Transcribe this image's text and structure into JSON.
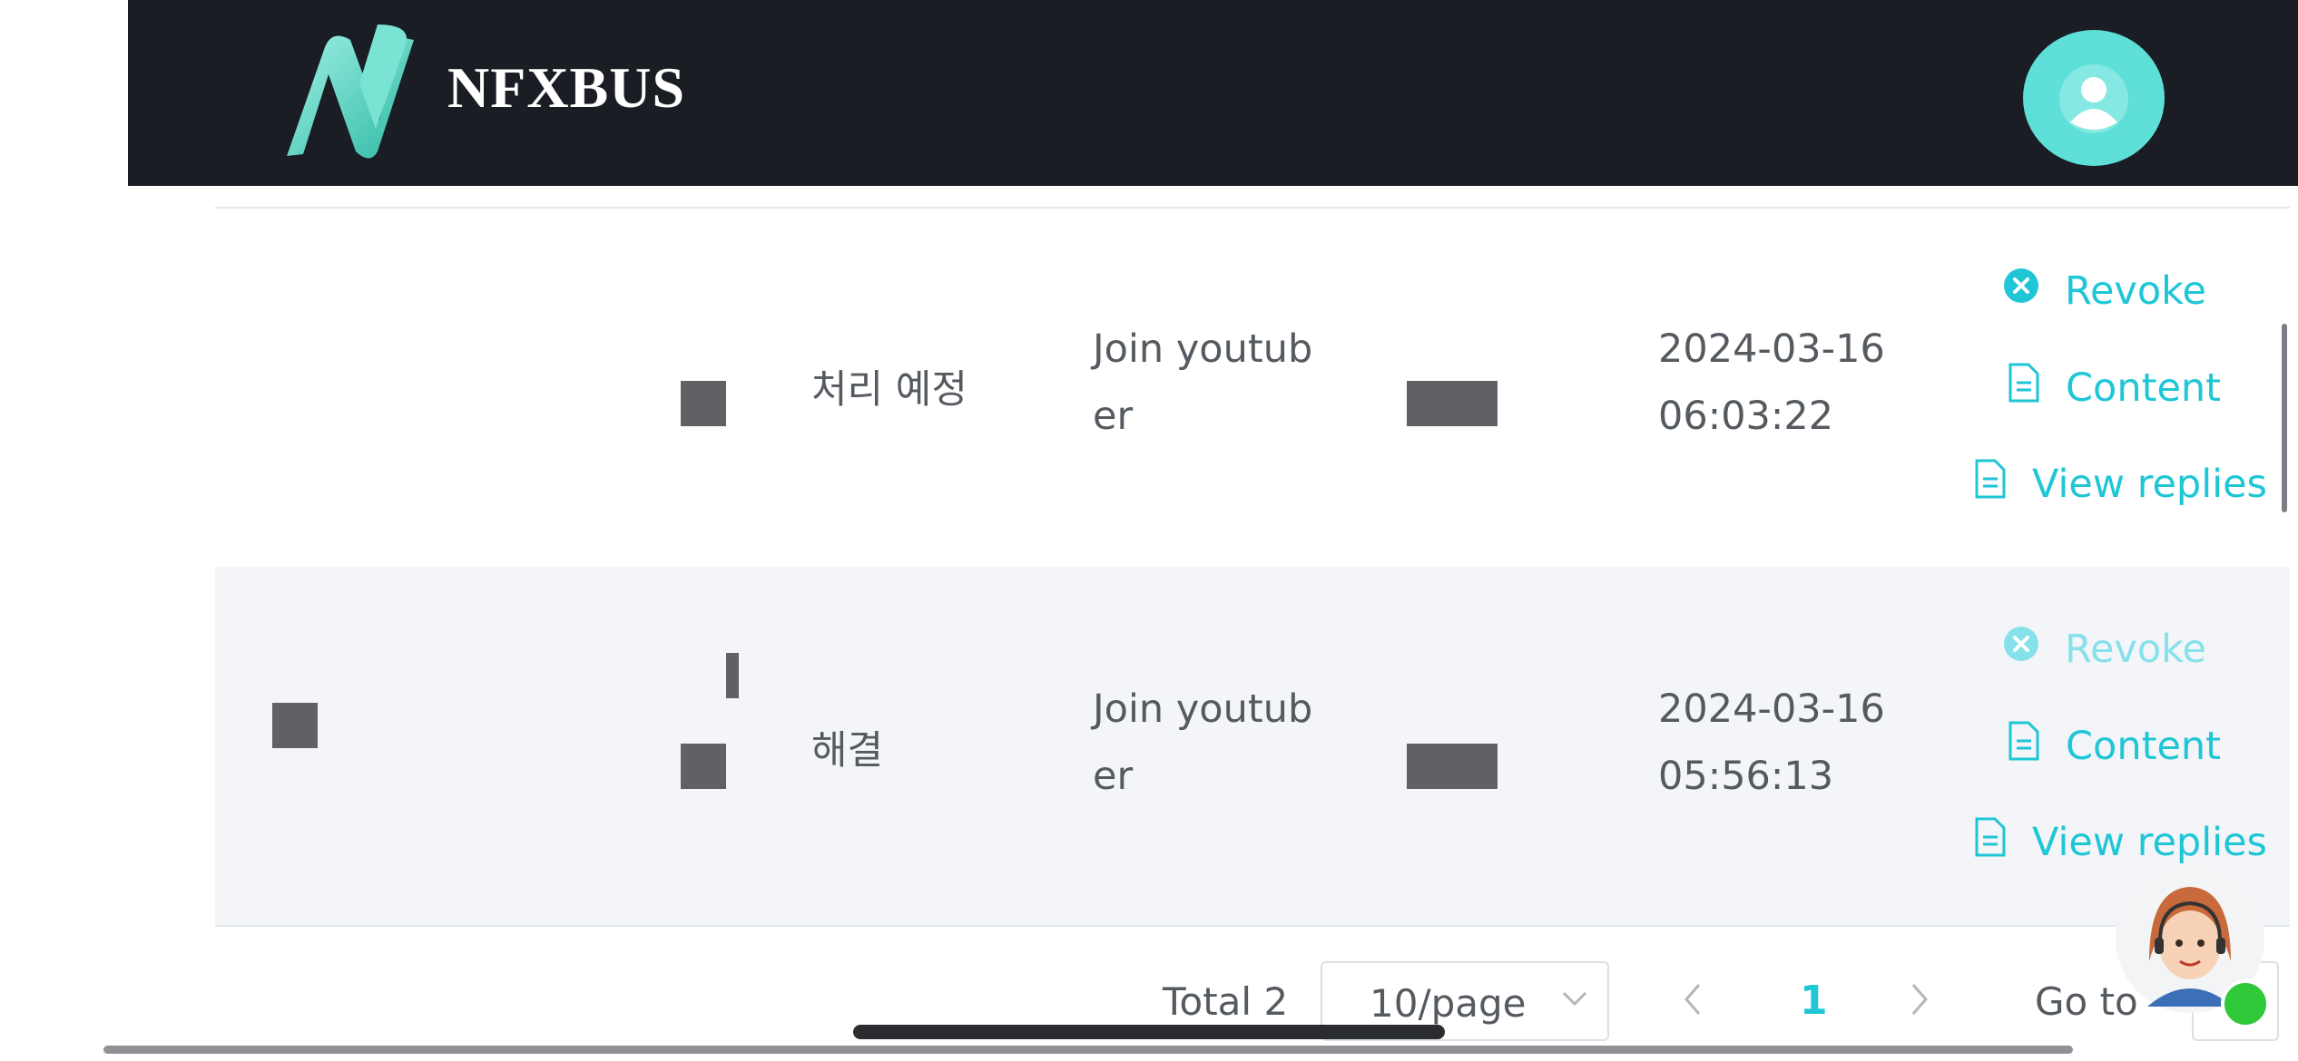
{
  "app": {
    "brand": "NFXBUS"
  },
  "header": {
    "logo_icon": "nfxbus-logo-icon",
    "avatar_icon": "user-avatar-icon"
  },
  "colors": {
    "accent": "#1ec6d6",
    "header_bg": "#1a1d23",
    "avatar_bg": "#5ee0d8",
    "redaction": "#606165"
  },
  "rows": [
    {
      "status": "처리 예정",
      "title_line1": "Join youtub",
      "title_line2": "er",
      "date": "2024-03-16",
      "time": "06:03:22",
      "actions": {
        "revoke": "Revoke",
        "content": "Content",
        "replies": "View replies"
      },
      "revoke_disabled": false
    },
    {
      "status": "해결",
      "title_line1": "Join youtub",
      "title_line2": "er",
      "date": "2024-03-16",
      "time": "05:56:13",
      "actions": {
        "revoke": "Revoke",
        "content": "Content",
        "replies": "View replies"
      },
      "revoke_disabled": true
    }
  ],
  "pagination": {
    "total": "Total 2",
    "page_size": "10/page",
    "current_page": "1",
    "goto_label": "Go to"
  }
}
